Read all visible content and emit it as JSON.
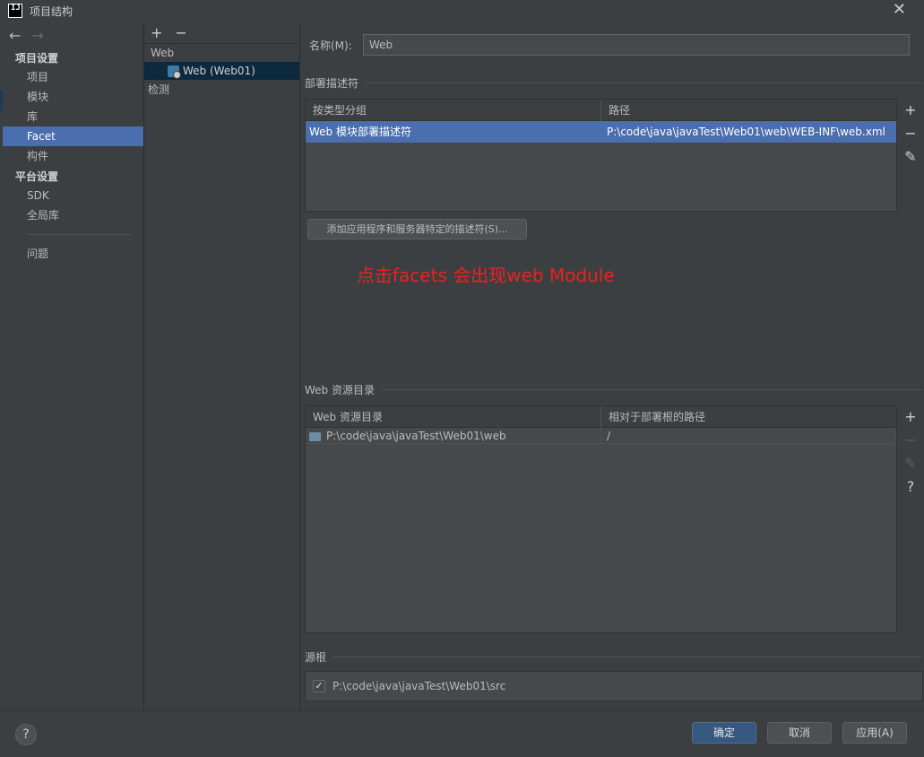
{
  "window": {
    "title": "项目结构"
  },
  "leftnav": {
    "group_project": "项目设置",
    "items_project": [
      "项目",
      "模块",
      "库",
      "Facet",
      "构件"
    ],
    "group_platform": "平台设置",
    "items_platform": [
      "SDK",
      "全局库"
    ],
    "item_problems": "问题"
  },
  "middle": {
    "root": "Web",
    "child": "Web (Web01)",
    "root2": "检测"
  },
  "right": {
    "name_label": "名称(M):",
    "name_value": "Web",
    "deploy_section": "部署描述符",
    "deploy_table": {
      "headers": [
        "按类型分组",
        "路径"
      ],
      "rows": [
        [
          "Web 模块部署描述符",
          "P:\\code\\java\\javaTest\\Web01\\web\\WEB-INF\\web.xml"
        ]
      ]
    },
    "add_descriptor_button": "添加应用程序和服务器特定的描述符(S)...",
    "annotation": "点击facets 会出现web Module",
    "web_res_section": "Web 资源目录",
    "web_res_table": {
      "headers": [
        "Web 资源目录",
        "相对于部署根的路径"
      ],
      "rows": [
        [
          "P:\\code\\java\\javaTest\\Web01\\web",
          "/"
        ]
      ]
    },
    "source_section": "源根",
    "source_path": "P:\\code\\java\\javaTest\\Web01\\src"
  },
  "buttons": {
    "ok": "确定",
    "cancel": "取消",
    "apply": "应用(A)",
    "help": "?"
  },
  "colors": {
    "accent": "#4b6eaf",
    "annotation": "#e8231f",
    "primary_btn": "#365880"
  },
  "icons": {
    "add": "plus-icon",
    "remove": "minus-icon",
    "edit": "pencil-icon",
    "help": "question-icon"
  }
}
